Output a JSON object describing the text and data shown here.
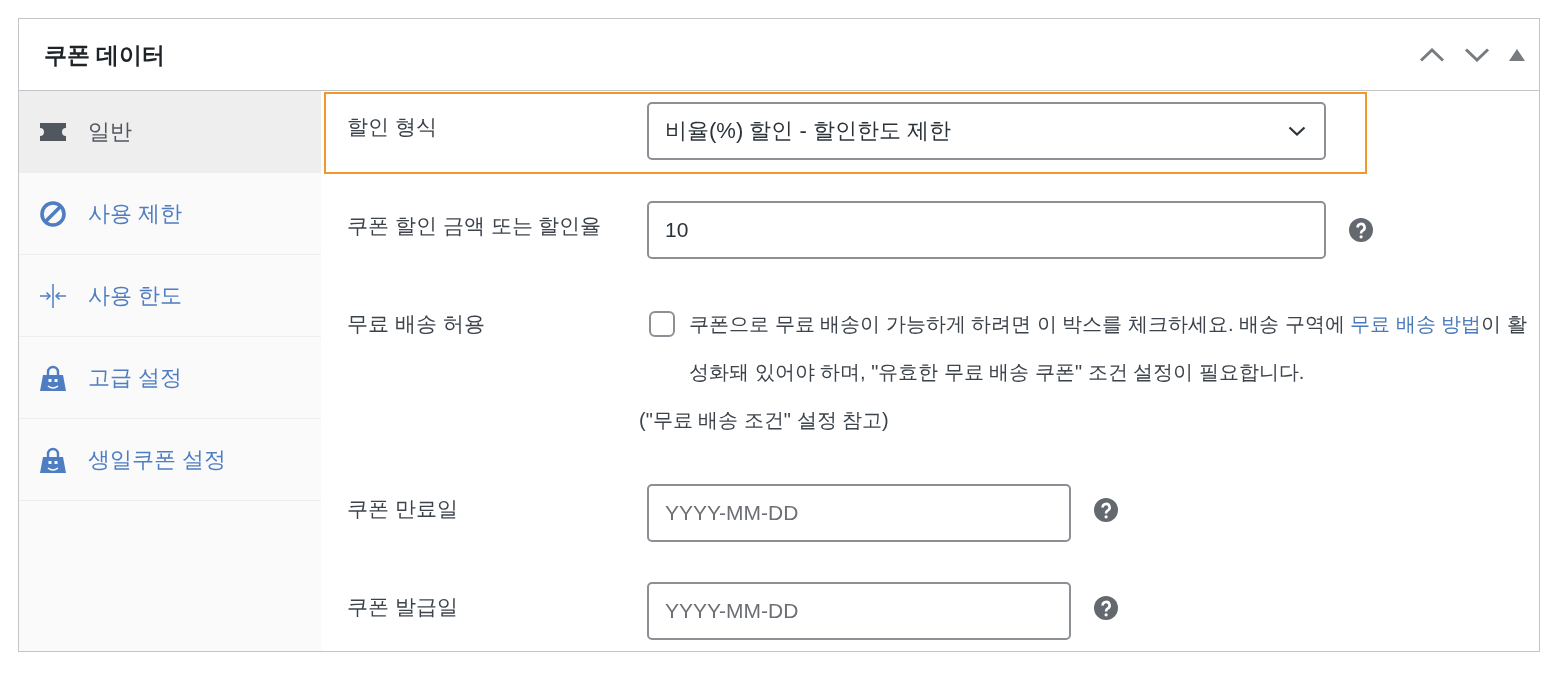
{
  "panel": {
    "title": "쿠폰 데이터"
  },
  "tabs": [
    {
      "label": "일반",
      "kind": "general",
      "selected": true
    },
    {
      "label": "사용 제한",
      "kind": "restriction",
      "selected": false
    },
    {
      "label": "사용 한도",
      "kind": "limit",
      "selected": false
    },
    {
      "label": "고급 설정",
      "kind": "addon",
      "selected": false
    },
    {
      "label": "생일쿠폰 설정",
      "kind": "addon",
      "selected": false
    }
  ],
  "fields": [
    {
      "kind": "select",
      "label": "할인 형식",
      "value": "비율(%) 할인 - 할인한도 제한",
      "focused": true,
      "help": false
    },
    {
      "kind": "text",
      "label": "쿠폰 할인 금액 또는 할인율",
      "value": "10",
      "focused": false,
      "help": true
    },
    {
      "kind": "checkbox",
      "label": "무료 배송 허용",
      "checked": false,
      "focused": false,
      "help": false,
      "description": {
        "before": "쿠폰으로 무료 배송이 가능하게 하려면 이 박스를 체크하세요. 배송 구역에 ",
        "link": "무료 배송 방법",
        "after": "이 활성화돼 있어야 하며, \"유효한 무료 배송 쿠폰\" 조건 설정이 필요합니다."
      },
      "note": "(\"무료 배송 조건\" 설정 참고)"
    },
    {
      "kind": "date",
      "label": "쿠폰 만료일",
      "placeholder": "YYYY-MM-DD",
      "focused": false,
      "help": true
    },
    {
      "kind": "date",
      "label": "쿠폰 발급일",
      "placeholder": "YYYY-MM-DD",
      "focused": false,
      "help": true
    }
  ]
}
